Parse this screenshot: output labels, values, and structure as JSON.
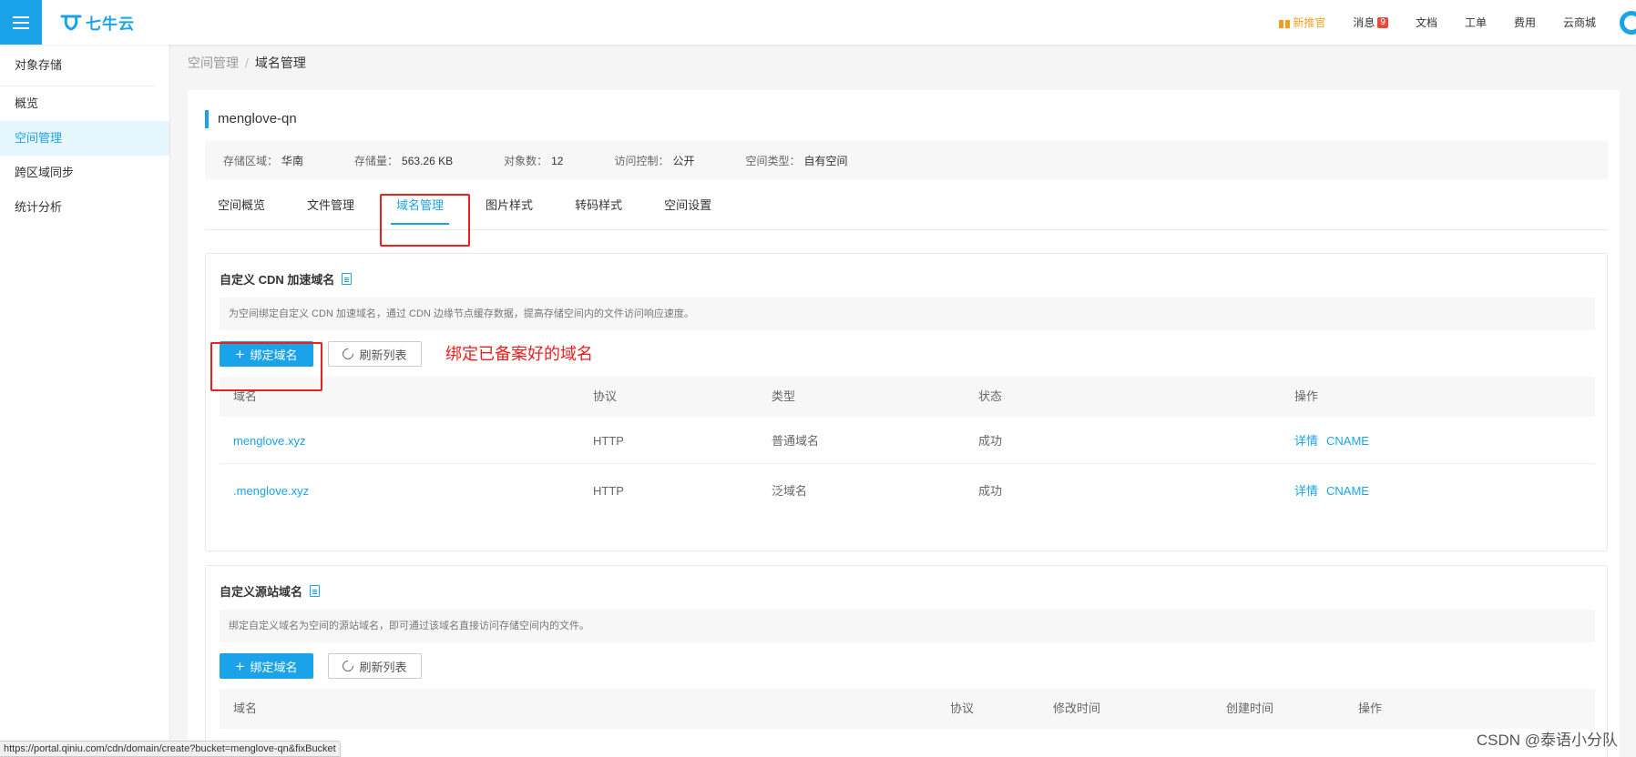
{
  "header": {
    "logo_text": "七牛云",
    "nav": {
      "promo": "新推官",
      "messages": "消息",
      "messages_badge": "9",
      "docs": "文档",
      "tickets": "工单",
      "billing": "费用",
      "marketplace": "云商城"
    }
  },
  "sidebar": {
    "title": "对象存储",
    "items": [
      {
        "label": "概览"
      },
      {
        "label": "空间管理"
      },
      {
        "label": "跨区域同步"
      },
      {
        "label": "统计分析"
      }
    ]
  },
  "breadcrumb": {
    "parent": "空间管理",
    "separator": "/",
    "current": "域名管理"
  },
  "bucket": {
    "name": "menglove-qn",
    "info": [
      {
        "label": "存储区域：",
        "value": "华南"
      },
      {
        "label": "存储量：",
        "value": "563.26 KB"
      },
      {
        "label": "对象数：",
        "value": "12"
      },
      {
        "label": "访问控制：",
        "value": "公开"
      },
      {
        "label": "空间类型：",
        "value": "自有空间"
      }
    ]
  },
  "tabs": [
    {
      "label": "空间概览"
    },
    {
      "label": "文件管理"
    },
    {
      "label": "域名管理"
    },
    {
      "label": "图片样式"
    },
    {
      "label": "转码样式"
    },
    {
      "label": "空间设置"
    }
  ],
  "cdn_section": {
    "title": "自定义 CDN 加速域名",
    "description": "为空间绑定自定义 CDN 加速域名，通过 CDN 边缘节点缓存数据，提高存储空间内的文件访问响应速度。",
    "bind_button": "绑定域名",
    "refresh_button": "刷新列表",
    "annotation": "绑定已备案好的域名",
    "columns": [
      "域名",
      "协议",
      "类型",
      "状态",
      "操作"
    ],
    "rows": [
      {
        "domain": "menglove.xyz",
        "protocol": "HTTP",
        "type": "普通域名",
        "status": "成功",
        "action_detail": "详情",
        "action_cname": "CNAME"
      },
      {
        "domain": ".menglove.xyz",
        "protocol": "HTTP",
        "type": "泛域名",
        "status": "成功",
        "action_detail": "详情",
        "action_cname": "CNAME"
      }
    ]
  },
  "origin_section": {
    "title": "自定义源站域名",
    "description": "绑定自定义域名为空间的源站域名，即可通过该域名直接访问存储空间内的文件。",
    "bind_button": "绑定域名",
    "refresh_button": "刷新列表",
    "columns": [
      "域名",
      "协议",
      "修改时间",
      "创建时间",
      "操作"
    ]
  },
  "statusbar": {
    "url": "https://portal.qiniu.com/cdn/domain/create?bucket=menglove-qn&fixBucket"
  },
  "watermark": "CSDN @泰语小分队"
}
